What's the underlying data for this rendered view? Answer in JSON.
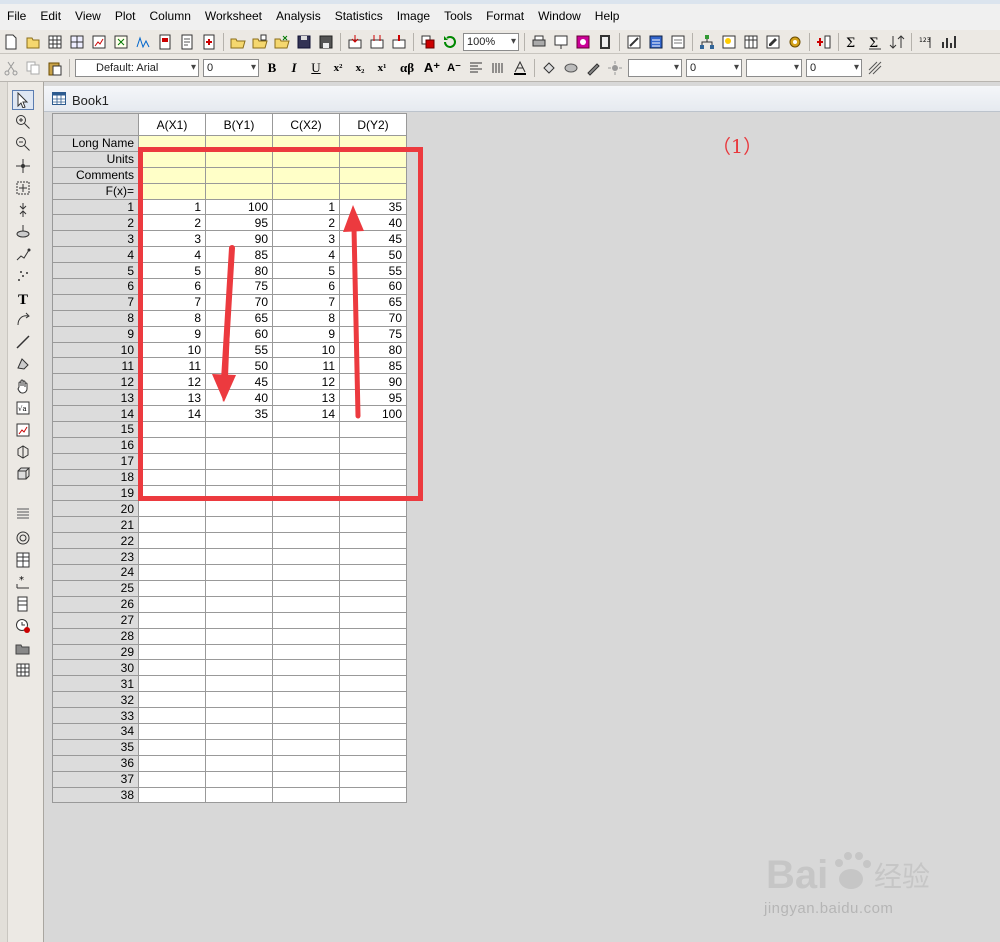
{
  "menu": [
    "File",
    "Edit",
    "View",
    "Plot",
    "Column",
    "Worksheet",
    "Analysis",
    "Statistics",
    "Image",
    "Tools",
    "Format",
    "Window",
    "Help"
  ],
  "toolbar": {
    "zoom": "100%",
    "font": "Default: Arial",
    "font_size": "0",
    "line_width": "0",
    "border_width": "0"
  },
  "workbook": {
    "title": "Book1",
    "columns": [
      "A(X1)",
      "B(Y1)",
      "C(X2)",
      "D(Y2)"
    ],
    "meta_rows": [
      "Long Name",
      "Units",
      "Comments",
      "F(x)="
    ],
    "rows": [
      [
        "1",
        "1",
        "100",
        "1",
        "35"
      ],
      [
        "2",
        "2",
        "95",
        "2",
        "40"
      ],
      [
        "3",
        "3",
        "90",
        "3",
        "45"
      ],
      [
        "4",
        "4",
        "85",
        "4",
        "50"
      ],
      [
        "5",
        "5",
        "80",
        "5",
        "55"
      ],
      [
        "6",
        "6",
        "75",
        "6",
        "60"
      ],
      [
        "7",
        "7",
        "70",
        "7",
        "65"
      ],
      [
        "8",
        "8",
        "65",
        "8",
        "70"
      ],
      [
        "9",
        "9",
        "60",
        "9",
        "75"
      ],
      [
        "10",
        "10",
        "55",
        "10",
        "80"
      ],
      [
        "11",
        "11",
        "50",
        "11",
        "85"
      ],
      [
        "12",
        "12",
        "45",
        "12",
        "90"
      ],
      [
        "13",
        "13",
        "40",
        "13",
        "95"
      ],
      [
        "14",
        "14",
        "35",
        "14",
        "100"
      ],
      [
        "15",
        "",
        "",
        "",
        ""
      ],
      [
        "16",
        "",
        "",
        "",
        ""
      ],
      [
        "17",
        "",
        "",
        "",
        ""
      ],
      [
        "18",
        "",
        "",
        "",
        ""
      ],
      [
        "19",
        "",
        "",
        "",
        ""
      ],
      [
        "20",
        "",
        "",
        "",
        ""
      ],
      [
        "21",
        "",
        "",
        "",
        ""
      ],
      [
        "22",
        "",
        "",
        "",
        ""
      ],
      [
        "23",
        "",
        "",
        "",
        ""
      ],
      [
        "24",
        "",
        "",
        "",
        ""
      ],
      [
        "25",
        "",
        "",
        "",
        ""
      ],
      [
        "26",
        "",
        "",
        "",
        ""
      ],
      [
        "27",
        "",
        "",
        "",
        ""
      ],
      [
        "28",
        "",
        "",
        "",
        ""
      ],
      [
        "29",
        "",
        "",
        "",
        ""
      ],
      [
        "30",
        "",
        "",
        "",
        ""
      ],
      [
        "31",
        "",
        "",
        "",
        ""
      ],
      [
        "32",
        "",
        "",
        "",
        ""
      ],
      [
        "33",
        "",
        "",
        "",
        ""
      ],
      [
        "34",
        "",
        "",
        "",
        ""
      ],
      [
        "35",
        "",
        "",
        "",
        ""
      ],
      [
        "36",
        "",
        "",
        "",
        ""
      ],
      [
        "37",
        "",
        "",
        "",
        ""
      ],
      [
        "38",
        "",
        "",
        "",
        ""
      ]
    ]
  },
  "annotation": {
    "label": "（1）",
    "color": "#e8383d"
  },
  "watermark": {
    "brand": "Bai经验",
    "url": "jingyan.baidu.com"
  }
}
